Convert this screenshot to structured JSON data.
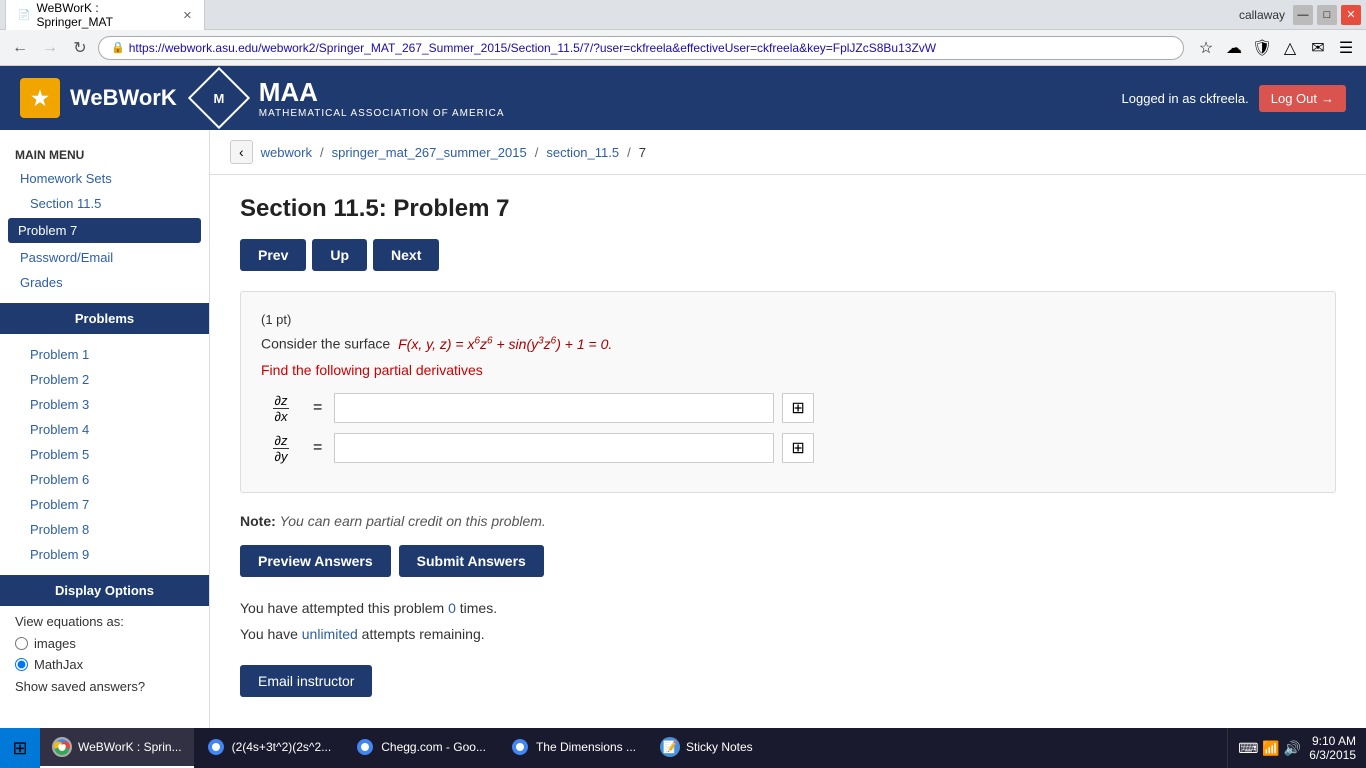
{
  "browser": {
    "tab_title": "WeBWorK : Springer_MAT",
    "url": "https://webwork.asu.edu/webwork2/Springer_MAT_267_Summer_2015/Section_11.5/7/?user=ckfreela&effectiveUser=ckfreela&key=FplJZcS8Bu13ZvW",
    "user": "callaway"
  },
  "header": {
    "logo_text": "WeBWorK",
    "maa_title": "MAA",
    "maa_subtitle": "MATHEMATICAL ASSOCIATION OF AMERICA",
    "logged_in_text": "Logged in as ckfreela.",
    "logout_label": "Log Out"
  },
  "sidebar": {
    "main_menu_label": "MAIN MENU",
    "homework_sets_label": "Homework Sets",
    "section_11_5_label": "Section 11.5",
    "problem_7_label": "Problem 7",
    "password_email_label": "Password/Email",
    "grades_label": "Grades",
    "problems_header": "Problems",
    "problem_links": [
      "Problem 1",
      "Problem 2",
      "Problem 3",
      "Problem 4",
      "Problem 5",
      "Problem 6",
      "Problem 7",
      "Problem 8",
      "Problem 9"
    ],
    "display_options_header": "Display Options",
    "view_equations_label": "View equations as:",
    "images_label": "images",
    "mathjax_label": "MathJax",
    "show_saved_label": "Show saved answers?"
  },
  "breadcrumb": {
    "back_icon": "‹",
    "webwork": "webwork",
    "course": "springer_mat_267_summer_2015",
    "section": "section_11.5",
    "problem_num": "7"
  },
  "problem": {
    "title": "Section 11.5: Problem 7",
    "prev_label": "Prev",
    "up_label": "Up",
    "next_label": "Next",
    "points": "(1 pt)",
    "description_plain": "Consider the surface",
    "equation": "F(x, y, z) = x⁶z⁶ + sin(y³z⁶) + 1 = 0.",
    "find_text": "Find the following partial derivatives",
    "partial_z_x_label": "∂z/∂x",
    "partial_z_y_label": "∂z/∂y",
    "equals": "=",
    "note_label": "Note:",
    "note_text": "You can earn partial credit on this problem.",
    "preview_btn": "Preview Answers",
    "submit_btn": "Submit Answers",
    "attempts_text": "You have attempted this problem 0 times.",
    "unlimited_text": "You have unlimited attempts remaining.",
    "email_btn": "Email instructor"
  },
  "taskbar": {
    "start_icon": "⊞",
    "items": [
      {
        "id": "webwork",
        "icon": "chrome",
        "label": "WeBWorK : Sprin..."
      },
      {
        "id": "calc",
        "icon": "chrome",
        "label": "(2(4s+3t^2)(2s^2..."
      },
      {
        "id": "chegg",
        "icon": "chrome",
        "label": "Chegg.com - Goo..."
      },
      {
        "id": "dimensions",
        "icon": "chrome",
        "label": "The Dimensions ..."
      },
      {
        "id": "sticky",
        "icon": "sticky",
        "label": "Sticky Notes",
        "is_sticky": true
      }
    ],
    "time": "9:10 AM",
    "date": "6/3/2015"
  }
}
